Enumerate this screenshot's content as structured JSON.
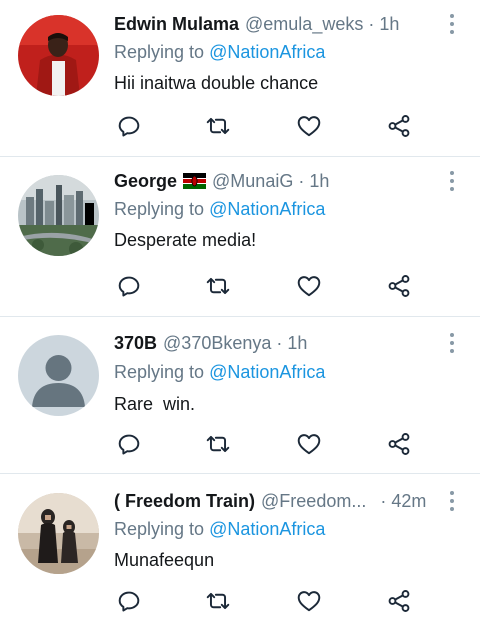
{
  "tweets": [
    {
      "name": "Edwin Mulama",
      "handle": "@emula_weks",
      "separator": "·",
      "time": "1h",
      "replying_prefix": "Replying to ",
      "replying_to": "@NationAfrica",
      "text": "Hii inaitwa double chance",
      "avatar_icon": "red-jacket-person-avatar"
    },
    {
      "name": "George",
      "handle": "@MunaiG",
      "separator": "·",
      "time": "1h",
      "replying_prefix": "Replying to ",
      "replying_to": "@NationAfrica",
      "text": "Desperate media!",
      "flag_icon": "kenya-flag-emoji",
      "avatar_icon": "city-skyline-avatar"
    },
    {
      "name": "370B",
      "handle": "@370Bkenya",
      "separator": "·",
      "time": "1h",
      "replying_prefix": "Replying to ",
      "replying_to": "@NationAfrica",
      "text": "Rare  win.",
      "avatar_icon": "default-profile-avatar"
    },
    {
      "name": "( Freedom Train)",
      "handle": "@Freedom...",
      "separator": "·",
      "time": "42m",
      "replying_prefix": "Replying to ",
      "replying_to": "@NationAfrica",
      "text": "Munafeequn",
      "avatar_icon": "two-people-avatar"
    }
  ],
  "action_icons": [
    "reply-icon",
    "retweet-icon",
    "like-icon",
    "share-icon"
  ],
  "colors": {
    "text": "#14171a",
    "secondary": "#657786",
    "link": "#1b95e0",
    "divider": "#e1e8ed",
    "icon": "#1c2938"
  }
}
